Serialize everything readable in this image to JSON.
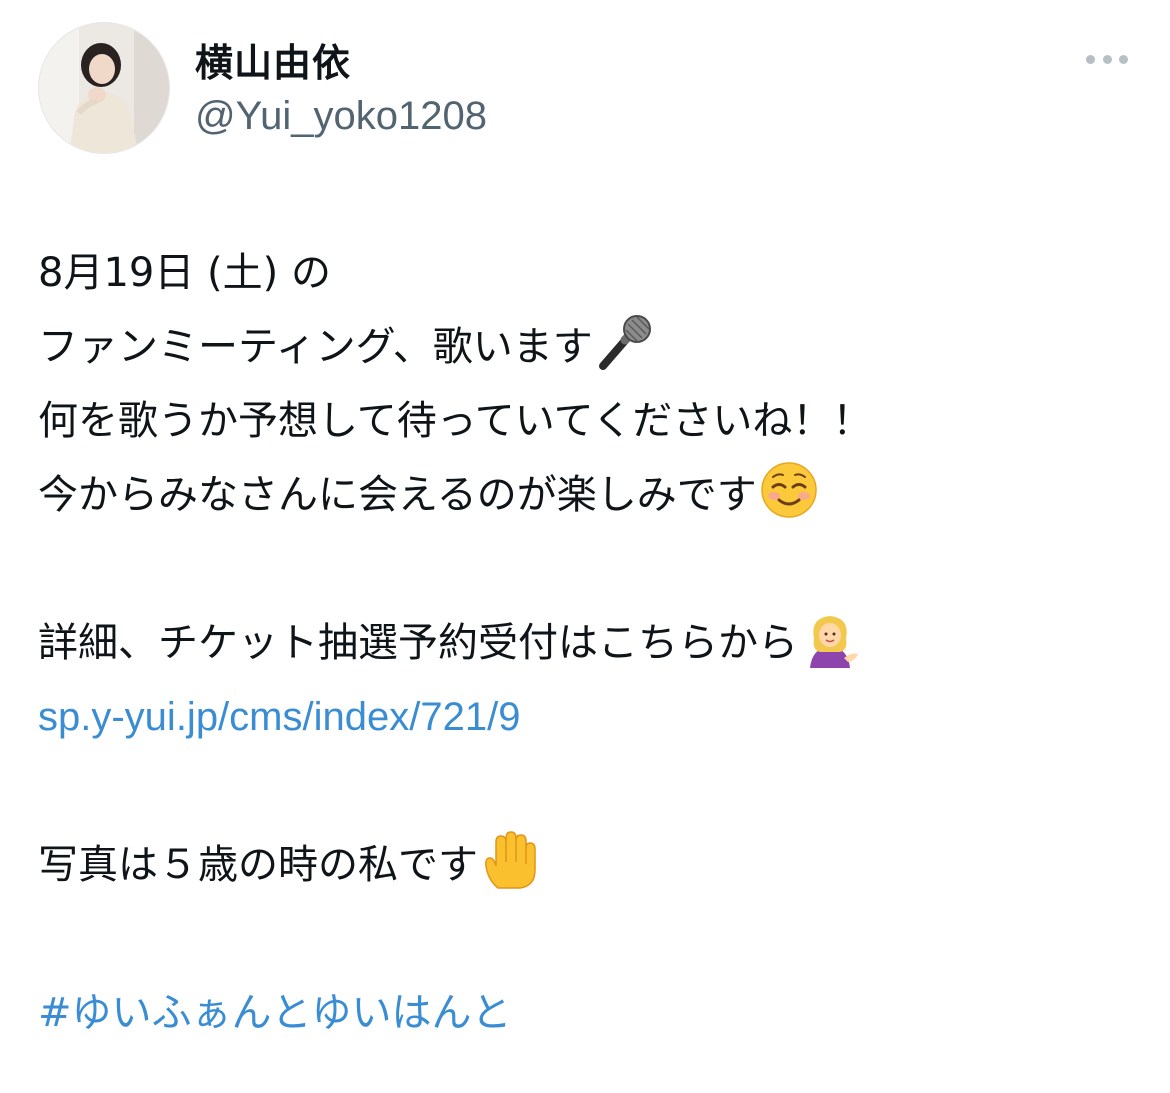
{
  "tweet": {
    "author": {
      "display_name": "横山由依",
      "handle": "@Yui_yoko1208",
      "avatar": "profile-photo"
    },
    "menu_icon": "more-horizontal-icon",
    "lines": [
      {
        "text": "8月19日 (土) の"
      },
      {
        "text": "ファンミーティング、歌います",
        "emoji": "microphone-emoji"
      },
      {
        "text": "何を歌うか予想して待っていてくださいね！！"
      },
      {
        "text": "今からみなさんに会えるのが楽しみです",
        "emoji": "smiling-face-emoji"
      },
      {
        "text": "詳細、チケット抽選予約受付はこちらから",
        "emoji": "tipping-hand-woman-emoji"
      },
      {
        "text": "写真は５歳の時の私です",
        "emoji": "raised-hand-emoji"
      }
    ],
    "link": "sp.y-yui.jp/cms/index/721/9",
    "hashtag": "#ゆいふぁんとゆいはんと"
  },
  "colors": {
    "text": "#0f1419",
    "secondary": "#536471",
    "link": "#3a8dd3",
    "menu_dots": "#b7bfc6",
    "background": "#ffffff"
  }
}
